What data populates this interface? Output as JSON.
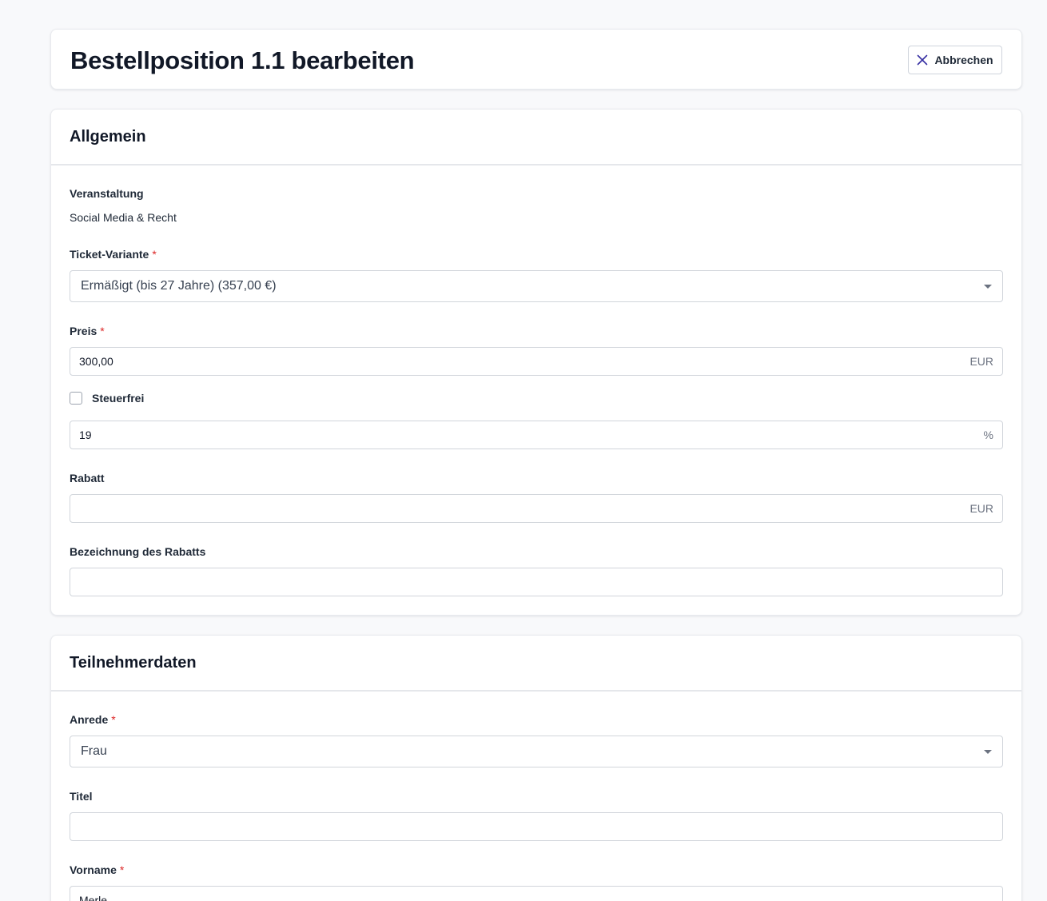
{
  "header": {
    "title": "Bestellposition 1.1 bearbeiten",
    "cancel_label": "Abbrechen"
  },
  "general": {
    "section_title": "Allgemein",
    "event_label": "Veranstaltung",
    "event_value": "Social Media & Recht",
    "ticket_variant_label": "Ticket-Variante",
    "ticket_variant_value": "Ermäßigt (bis 27 Jahre) (357,00 €)",
    "price_label": "Preis",
    "price_value": "300,00",
    "price_suffix": "EUR",
    "tax_free_label": "Steuerfrei",
    "tax_free_checked": false,
    "tax_value": "19",
    "tax_suffix": "%",
    "discount_label": "Rabatt",
    "discount_value": "",
    "discount_suffix": "EUR",
    "discount_name_label": "Bezeichnung des Rabatts",
    "discount_name_value": ""
  },
  "participant": {
    "section_title": "Teilnehmerdaten",
    "salutation_label": "Anrede",
    "salutation_value": "Frau",
    "title_label": "Titel",
    "title_value": "",
    "first_name_label": "Vorname",
    "first_name_value": "Merle"
  },
  "required_marker": "*",
  "colors": {
    "background": "#f8f9fb",
    "card": "#ffffff",
    "required": "#dc2626",
    "border": "#d1d5db"
  }
}
